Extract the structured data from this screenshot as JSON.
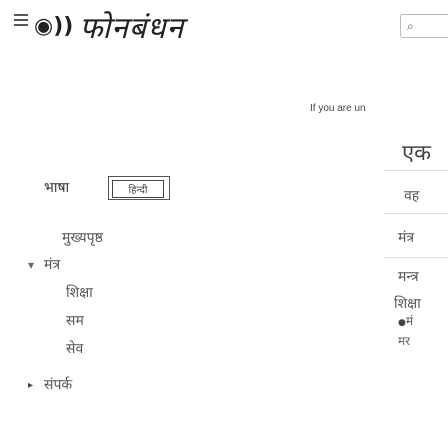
{
  "header": {
    "logo_mark": "=",
    "logo_signal": "◉))",
    "logo_text": "फोनबंधन",
    "search_icon": "search-icon"
  },
  "notice": "If you are un",
  "language": {
    "label": "भाषा",
    "button": "हिन्दी"
  },
  "sidebar": {
    "section": "मुख्यपृष्ठ",
    "expand_label": "मंत्र",
    "items": [
      {
        "label": "शिक्षा"
      },
      {
        "label": "सम"
      },
      {
        "label": "सेव"
      },
      {
        "label": "संपर्क"
      }
    ]
  },
  "right_col": {
    "items": [
      {
        "label": "एक"
      },
      {
        "label": "वह"
      },
      {
        "label": "मंत्र"
      },
      {
        "label": "मन्त्र"
      },
      {
        "label": "शिक्षा"
      },
      {
        "label": "मं"
      }
    ]
  }
}
